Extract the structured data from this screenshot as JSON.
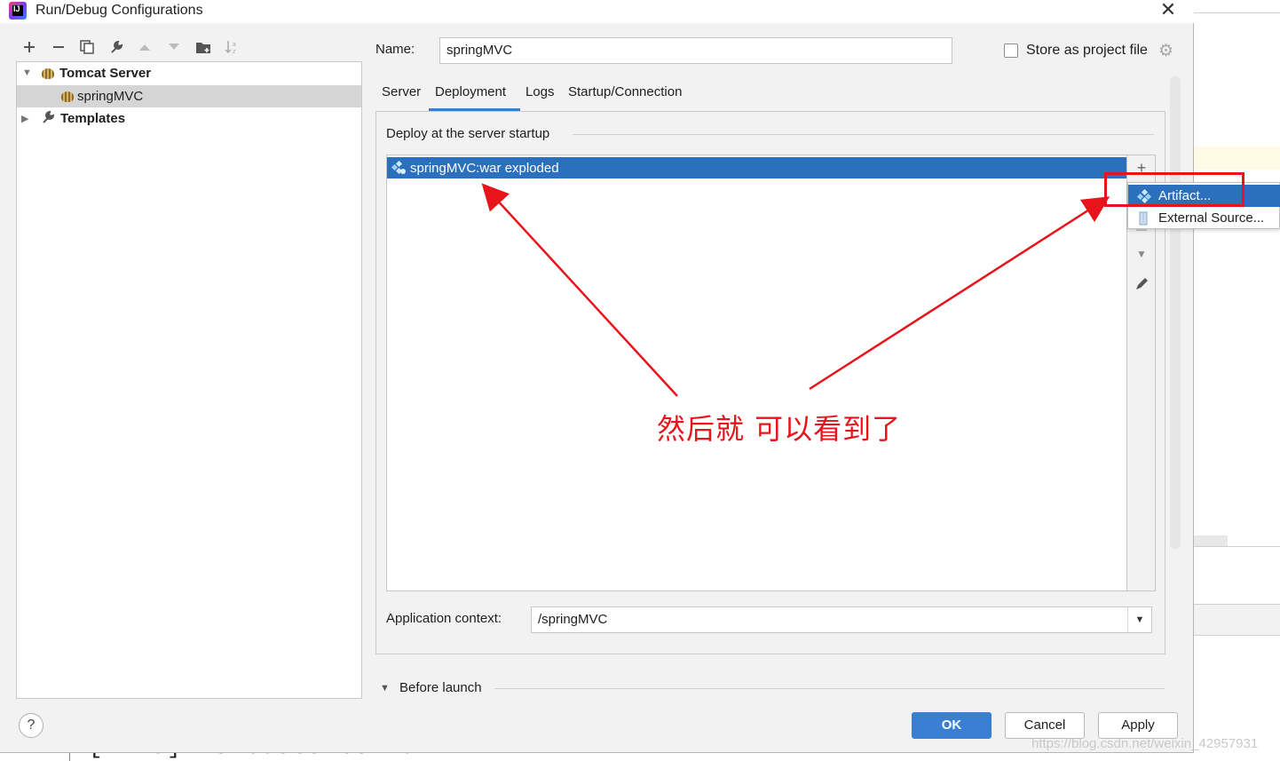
{
  "window": {
    "title": "Run/Debug Configurations"
  },
  "toolbar": {
    "items": [
      "add-icon",
      "remove-icon",
      "copy-icon",
      "wrench-icon",
      "move-up-icon",
      "move-down-icon",
      "folder-add-icon",
      "sort-icon"
    ]
  },
  "tree": {
    "tomcat": "Tomcat Server",
    "springmvc": "springMVC",
    "templates": "Templates"
  },
  "form": {
    "name_label": "Name:",
    "name_value": "springMVC",
    "store_label": "Store as project file",
    "store_checked": false
  },
  "tabs": [
    {
      "label": "Server"
    },
    {
      "label": "Deployment"
    },
    {
      "label": "Logs"
    },
    {
      "label": "Startup/Connection"
    }
  ],
  "active_tab": "Deployment",
  "deploy": {
    "section_label": "Deploy at the server startup",
    "items": [
      "springMVC:war exploded"
    ]
  },
  "popup": {
    "items": [
      "Artifact...",
      "External Source..."
    ]
  },
  "app_context": {
    "label": "Application context:",
    "value": "/springMVC"
  },
  "before_launch": {
    "label": "Before launch"
  },
  "buttons": {
    "ok": "OK",
    "cancel": "Cancel",
    "apply": "Apply"
  },
  "annotation": {
    "text": "然后就 可以看到了"
  },
  "background": {
    "console_text": "[INFO] No tests to run."
  },
  "watermark": "https://blog.csdn.net/weixin_42957931",
  "colors": {
    "selection": "#2c6fbd",
    "accent": "#3b7fd3",
    "annotation": "#e8141c"
  }
}
